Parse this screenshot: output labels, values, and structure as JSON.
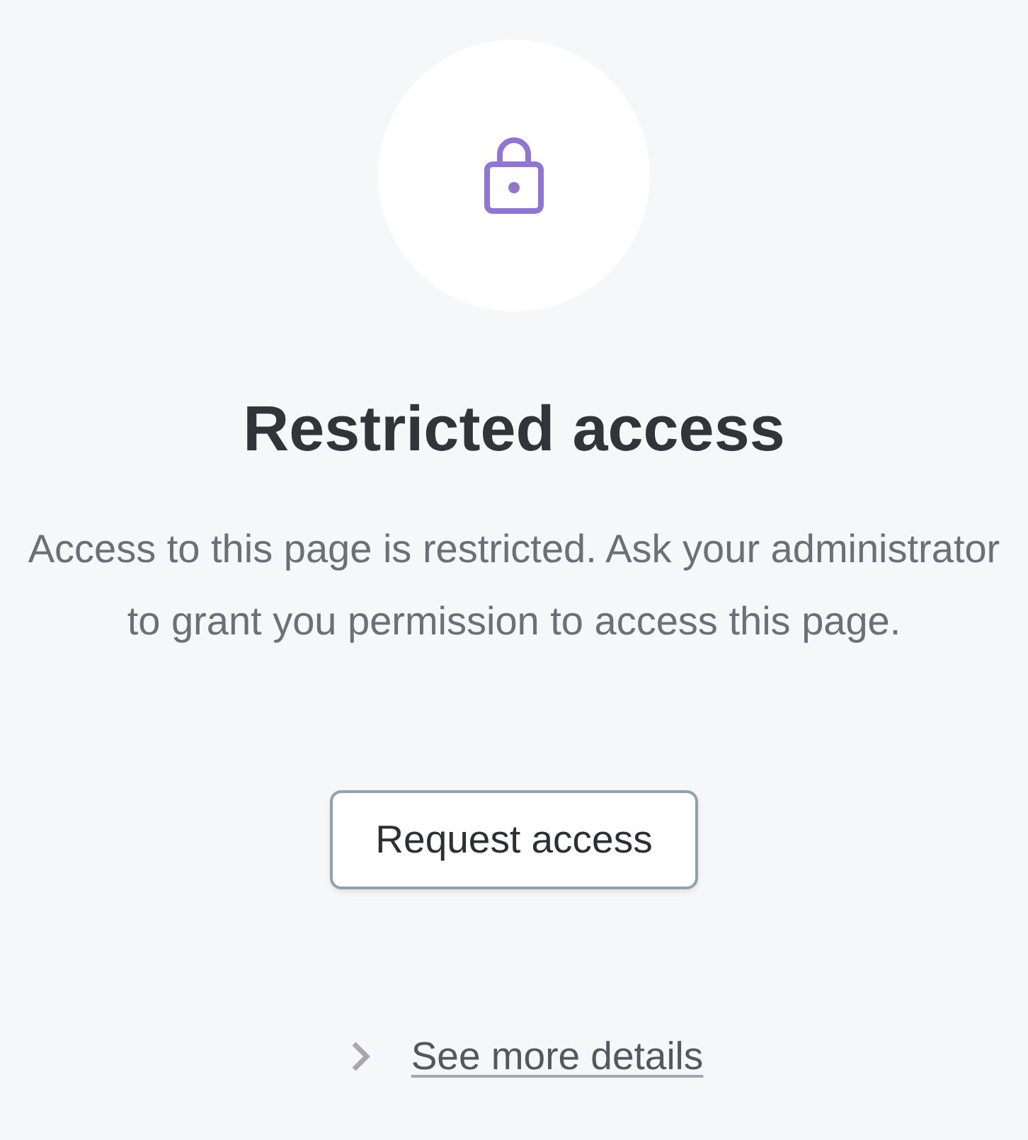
{
  "heading": "Restricted access",
  "message": "Access to this page is restricted. Ask your administrator to grant you permission to access this page.",
  "primary_button": {
    "label": "Request access"
  },
  "details_link": {
    "label": "See more details",
    "expanded": false
  }
}
